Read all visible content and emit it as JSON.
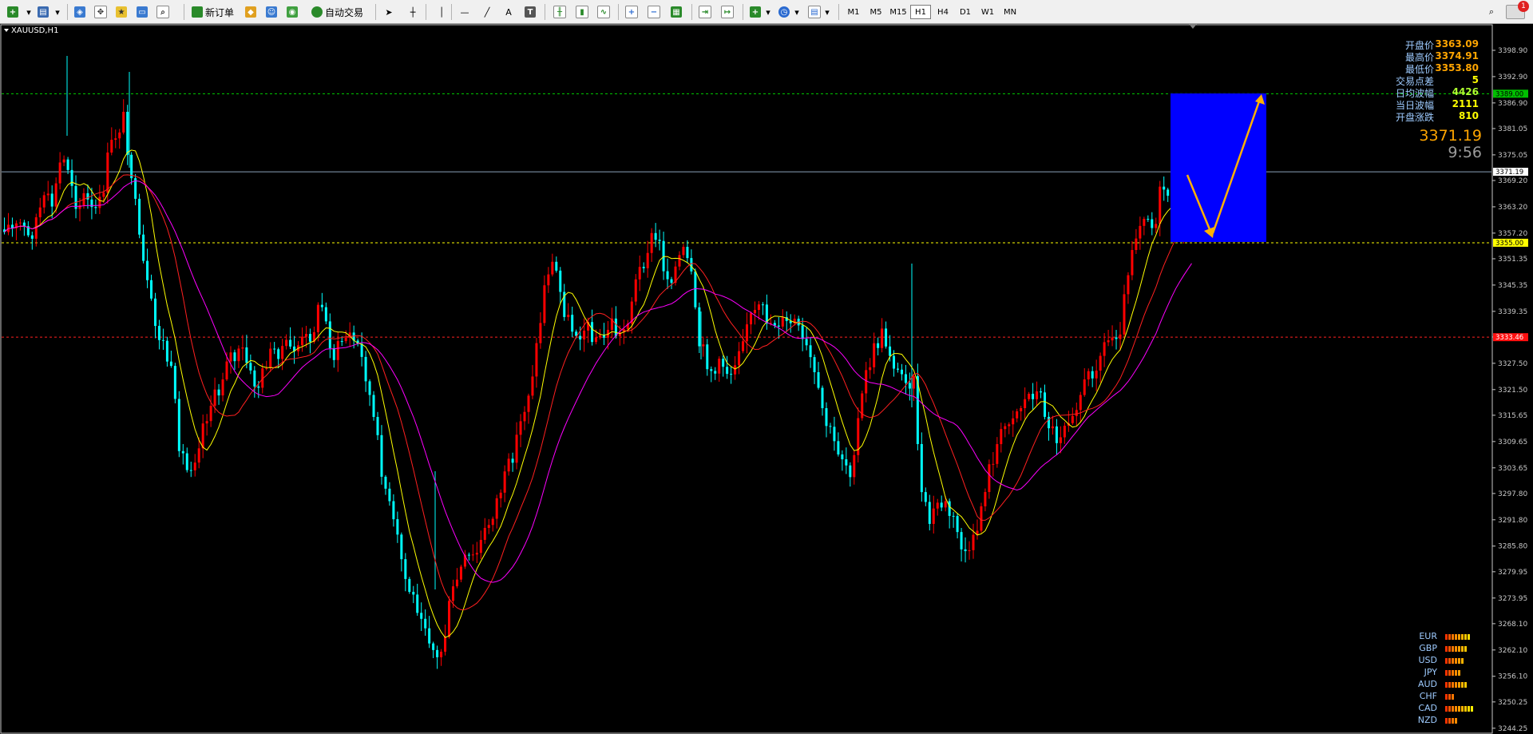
{
  "toolbar": {
    "new_order_label": "新订单",
    "auto_trade_label": "自动交易",
    "timeframes": [
      "M1",
      "M5",
      "M15",
      "H1",
      "H4",
      "D1",
      "W1",
      "MN"
    ],
    "active_timeframe": "H1",
    "notification_count": "1"
  },
  "chart": {
    "symbol_label": "XAUUSD,H1",
    "price_axis_labels": [
      "3398.90",
      "3392.90",
      "3386.90",
      "3381.05",
      "3375.05",
      "3369.20",
      "3363.20",
      "3357.20",
      "3351.35",
      "3345.35",
      "3339.35",
      "3333.50",
      "3327.50",
      "3321.50",
      "3315.65",
      "3309.65",
      "3303.65",
      "3297.80",
      "3291.80",
      "3285.80",
      "3279.95",
      "3273.95",
      "3268.10",
      "3262.10",
      "3256.10",
      "3250.25",
      "3244.25"
    ],
    "hlines": {
      "green_level": "3389.00",
      "current_price": "3371.19",
      "yellow_level": "3355.00",
      "red_level": "3333.46"
    },
    "colors": {
      "bull": "#ff0000",
      "bear": "#00ffff",
      "ma_fast": "#ffff00",
      "ma_mid": "#ff2020",
      "ma_slow": "#ff00ff",
      "target_box": "#0000ff",
      "arrow": "#ffb000"
    }
  },
  "info_panel": {
    "rows": [
      {
        "label": "开盘价",
        "value": "3363.09",
        "value_color": "#ffa500"
      },
      {
        "label": "最高价",
        "value": "3374.91",
        "value_color": "#ffa500"
      },
      {
        "label": "最低价",
        "value": "3353.80",
        "value_color": "#ffa500"
      },
      {
        "label": "交易点差",
        "value": "5",
        "value_color": "#ffff00"
      },
      {
        "label": "日均波幅",
        "value": "4426",
        "value_color": "#adff2f"
      },
      {
        "label": "当日波幅",
        "value": "2111",
        "value_color": "#ffff00"
      },
      {
        "label": "开盘涨跌",
        "value": "810",
        "value_color": "#ffff00"
      }
    ],
    "big_price": "3371.19",
    "countdown": "9:56"
  },
  "currency_strength": [
    {
      "code": "EUR",
      "bars": 8
    },
    {
      "code": "GBP",
      "bars": 7
    },
    {
      "code": "USD",
      "bars": 6
    },
    {
      "code": "JPY",
      "bars": 5
    },
    {
      "code": "AUD",
      "bars": 7
    },
    {
      "code": "CHF",
      "bars": 3
    },
    {
      "code": "CAD",
      "bars": 9
    },
    {
      "code": "NZD",
      "bars": 4
    }
  ]
}
